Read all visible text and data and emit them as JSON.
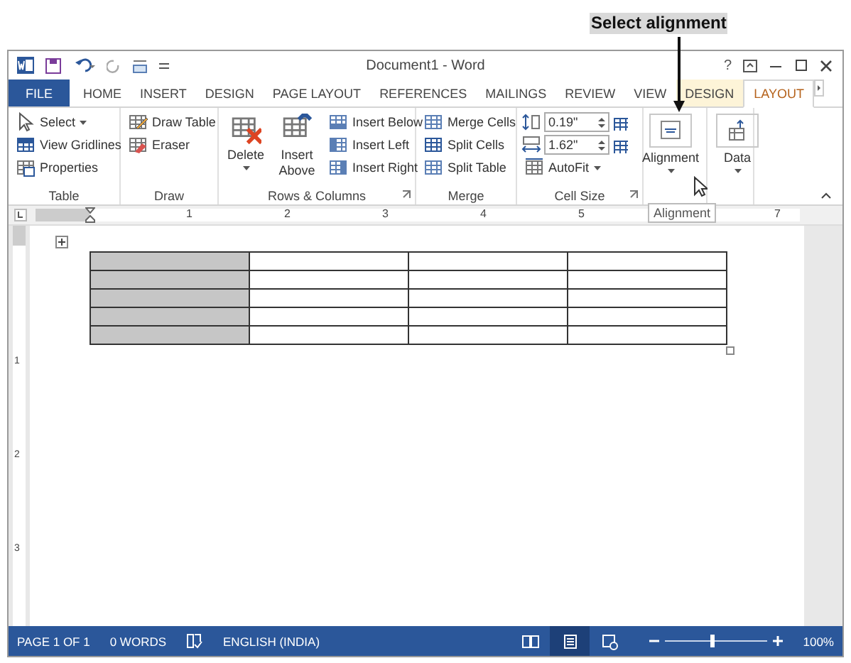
{
  "callout": {
    "text": "Select alignment"
  },
  "window": {
    "title": "Document1 - Word",
    "help": "?"
  },
  "tabs": [
    {
      "label": "FILE",
      "kind": "file",
      "selected": false
    },
    {
      "label": "HOME",
      "kind": "normal",
      "selected": false
    },
    {
      "label": "INSERT",
      "kind": "normal",
      "selected": false
    },
    {
      "label": "DESIGN",
      "kind": "normal",
      "selected": false
    },
    {
      "label": "PAGE LAYOUT",
      "kind": "normal",
      "selected": false
    },
    {
      "label": "REFERENCES",
      "kind": "normal",
      "selected": false
    },
    {
      "label": "MAILINGS",
      "kind": "normal",
      "selected": false
    },
    {
      "label": "REVIEW",
      "kind": "normal",
      "selected": false
    },
    {
      "label": "VIEW",
      "kind": "normal",
      "selected": false
    },
    {
      "label": "DESIGN",
      "kind": "contextual",
      "selected": false
    },
    {
      "label": "LAYOUT",
      "kind": "contextual",
      "selected": true
    }
  ],
  "ribbon": {
    "groups": [
      {
        "label": "Table",
        "items": [
          {
            "kind": "small",
            "label": "Select",
            "dropdown": true
          },
          {
            "kind": "small",
            "label": "View Gridlines"
          },
          {
            "kind": "small",
            "label": "Properties"
          }
        ]
      },
      {
        "label": "Draw",
        "items": [
          {
            "kind": "small",
            "label": "Draw Table"
          },
          {
            "kind": "small",
            "label": "Eraser"
          }
        ]
      },
      {
        "label": "Rows & Columns",
        "launcher": true,
        "items": [
          {
            "kind": "large",
            "label": "Delete",
            "dropdown": true
          },
          {
            "kind": "large",
            "label": "Insert Above"
          },
          {
            "kind": "small",
            "label": "Insert Below"
          },
          {
            "kind": "small",
            "label": "Insert Left"
          },
          {
            "kind": "small",
            "label": "Insert Right"
          }
        ]
      },
      {
        "label": "Merge",
        "items": [
          {
            "kind": "small",
            "label": "Merge Cells"
          },
          {
            "kind": "small",
            "label": "Split Cells"
          },
          {
            "kind": "small",
            "label": "Split Table"
          }
        ]
      },
      {
        "label": "Cell Size",
        "launcher": true,
        "items": [
          {
            "kind": "spin",
            "value": "0.19\""
          },
          {
            "kind": "spin",
            "value": "1.62\""
          },
          {
            "kind": "small",
            "label": "AutoFit",
            "dropdown": true
          }
        ]
      },
      {
        "items": [
          {
            "kind": "large",
            "label": "Alignment",
            "dropdown": true
          }
        ]
      },
      {
        "items": [
          {
            "kind": "large",
            "label": "Data",
            "dropdown": true
          }
        ]
      }
    ]
  },
  "tooltip": {
    "text": "Alignment"
  },
  "ruler": {
    "numbers": [
      "1",
      "2",
      "3",
      "4",
      "5",
      "7"
    ]
  },
  "vertical_ruler": {
    "numbers": [
      "1",
      "2",
      "3"
    ]
  },
  "table": {
    "rows": [
      {
        "cells": [
          {
            "selected": true
          },
          {
            "selected": false
          },
          {
            "selected": false
          },
          {
            "selected": false
          }
        ]
      },
      {
        "cells": [
          {
            "selected": true
          },
          {
            "selected": false
          },
          {
            "selected": false
          },
          {
            "selected": false
          }
        ]
      },
      {
        "cells": [
          {
            "selected": true
          },
          {
            "selected": false
          },
          {
            "selected": false
          },
          {
            "selected": false
          }
        ]
      },
      {
        "cells": [
          {
            "selected": true
          },
          {
            "selected": false
          },
          {
            "selected": false
          },
          {
            "selected": false
          }
        ]
      },
      {
        "cells": [
          {
            "selected": true
          },
          {
            "selected": false
          },
          {
            "selected": false
          },
          {
            "selected": false
          }
        ]
      }
    ]
  },
  "status_bar": {
    "page": "PAGE 1 OF 1",
    "words": "0 WORDS",
    "language": "ENGLISH (INDIA)",
    "views": [
      {
        "kind": "read",
        "selected": false
      },
      {
        "kind": "print",
        "selected": true
      },
      {
        "kind": "web",
        "selected": false
      }
    ],
    "zoom": {
      "level": 0.45,
      "reading": "100%"
    }
  }
}
